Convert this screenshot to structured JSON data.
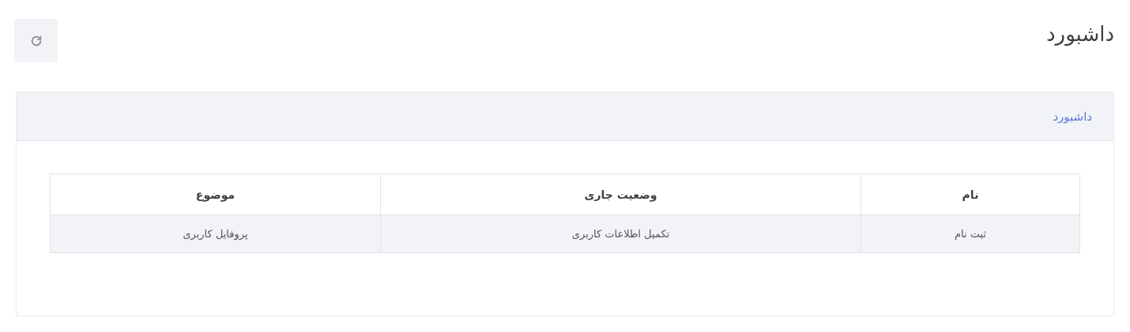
{
  "page": {
    "title": "داشبورد"
  },
  "card": {
    "breadcrumb": "داشبورد"
  },
  "table": {
    "columns": [
      "نام",
      "وضعیت جاری",
      "موضوع"
    ],
    "rows": [
      {
        "cells": [
          "ثبت نام",
          "تکمیل اطلاعات کاربری",
          "پروفایل کاربری"
        ]
      }
    ]
  }
}
